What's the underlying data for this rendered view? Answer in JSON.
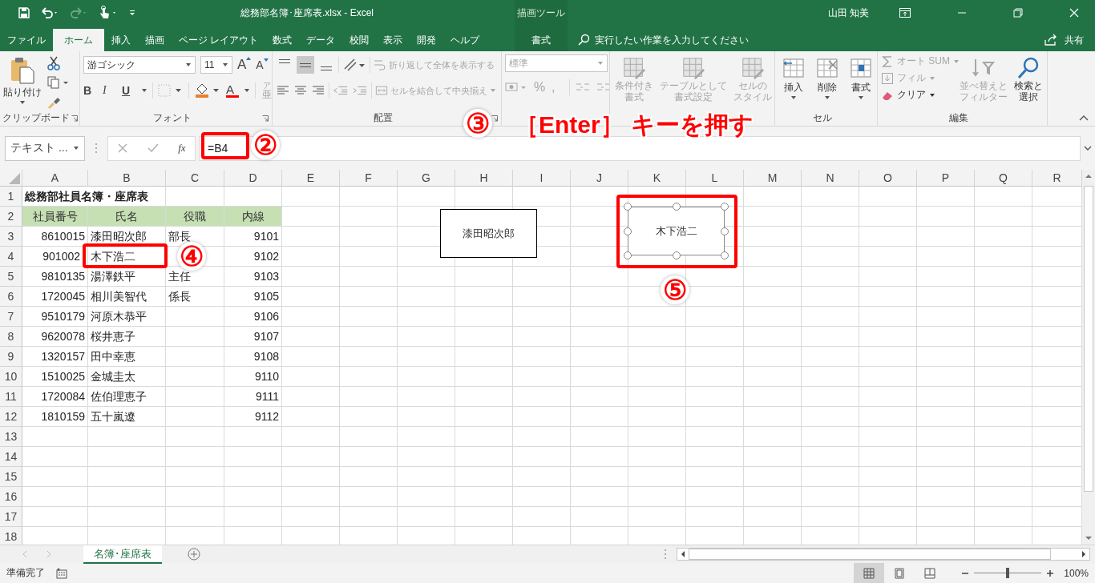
{
  "window": {
    "title": "総務部名簿･座席表.xlsx  -  Excel",
    "context_tool": "描画ツール",
    "user": "山田 知美"
  },
  "tabs": [
    {
      "label": "ファイル",
      "selected": false,
      "kind": "file"
    },
    {
      "label": "ホーム",
      "selected": true,
      "kind": "normal"
    },
    {
      "label": "挿入",
      "selected": false,
      "kind": "normal"
    },
    {
      "label": "描画",
      "selected": false,
      "kind": "normal"
    },
    {
      "label": "ページ レイアウト",
      "selected": false,
      "kind": "normal"
    },
    {
      "label": "数式",
      "selected": false,
      "kind": "normal"
    },
    {
      "label": "データ",
      "selected": false,
      "kind": "normal"
    },
    {
      "label": "校閲",
      "selected": false,
      "kind": "normal"
    },
    {
      "label": "表示",
      "selected": false,
      "kind": "normal"
    },
    {
      "label": "開発",
      "selected": false,
      "kind": "normal"
    },
    {
      "label": "ヘルプ",
      "selected": false,
      "kind": "normal"
    },
    {
      "label": "書式",
      "selected": false,
      "kind": "context"
    }
  ],
  "search": {
    "placeholder": "実行したい作業を入力してください"
  },
  "share": "共有",
  "ribbon": {
    "clipboard": {
      "paste": "貼り付け",
      "label": "クリップボード"
    },
    "font": {
      "name": "游ゴシック",
      "size": "11",
      "grow": "A",
      "shrink": "A",
      "styles": [
        "B",
        "I",
        "U"
      ],
      "color_label": "A",
      "phonetic_ruby": "ア",
      "phonetic_base": "亜",
      "label": "フォント"
    },
    "alignment": {
      "vertical": [
        {
          "selected": false
        },
        {
          "selected": true
        },
        {
          "selected": false
        }
      ],
      "wrap": {
        "label": "折り返して全体を表示する",
        "disabled": true
      },
      "merge": {
        "label": "セルを結合して中央揃え",
        "disabled": true
      },
      "label": "配置"
    },
    "number": {
      "format": "標準",
      "percent": "%",
      "comma": ",",
      "disabled": true
    },
    "styles": [
      {
        "lines": [
          "条件付き",
          "書式"
        ],
        "disabled": true
      },
      {
        "lines": [
          "テーブルとして",
          "書式設定"
        ],
        "disabled": true
      },
      {
        "lines": [
          "セルの",
          "スタイル"
        ],
        "disabled": true
      }
    ],
    "cells": {
      "buttons": [
        {
          "label": "挿入"
        },
        {
          "label": "削除"
        },
        {
          "label": "書式"
        }
      ],
      "label": "セル"
    },
    "editing": {
      "items": [
        {
          "label": "オート SUM",
          "disabled": true
        },
        {
          "label": "フィル",
          "disabled": true
        },
        {
          "label": "クリア",
          "disabled": false
        }
      ],
      "sort": {
        "lines": [
          "並べ替えと",
          "フィルター"
        ],
        "disabled": true
      },
      "find": {
        "lines": [
          "検索と",
          "選択"
        ],
        "disabled": false
      },
      "label": "編集"
    }
  },
  "formula_bar": {
    "name_box": "テキスト ...",
    "fx": "fx",
    "value": "=B4"
  },
  "sheet": {
    "columns": [
      "A",
      "B",
      "C",
      "D",
      "E",
      "F",
      "G",
      "H",
      "I",
      "J",
      "K",
      "L",
      "M",
      "N",
      "O",
      "P",
      "Q",
      "R"
    ],
    "row_numbers": [
      "1",
      "2",
      "3",
      "4",
      "5",
      "6",
      "7",
      "8",
      "9",
      "10",
      "11",
      "12",
      "13",
      "14",
      "15",
      "16",
      "17",
      "18"
    ],
    "title": "総務部社員名簿・座席表",
    "headers": [
      "社員番号",
      "氏名",
      "役職",
      "内線"
    ],
    "rows": [
      {
        "id": "8610015",
        "name": "漆田昭次郎",
        "role": "部長",
        "ext": "9101"
      },
      {
        "id": "901002",
        "name": "木下浩二",
        "ext": "9102"
      },
      {
        "id": "9810135",
        "name": "湯澤鉄平",
        "role": "主任",
        "ext": "9103"
      },
      {
        "id": "1720045",
        "name": "相川美智代",
        "role": "係長",
        "ext": "9105"
      },
      {
        "id": "9510179",
        "name": "河原木恭平",
        "ext": "9106"
      },
      {
        "id": "9620078",
        "name": "桜井恵子",
        "ext": "9107"
      },
      {
        "id": "1320157",
        "name": "田中幸恵",
        "ext": "9108"
      },
      {
        "id": "1510025",
        "name": "金城圭太",
        "ext": "9110"
      },
      {
        "id": "1720084",
        "name": "佐伯理恵子",
        "ext": "9111"
      },
      {
        "id": "1810159",
        "name": "五十嵐遼",
        "ext": "9112"
      }
    ]
  },
  "shapes": [
    {
      "text": "漆田昭次郎",
      "selected": false
    },
    {
      "text": "木下浩二",
      "selected": true
    }
  ],
  "annotations": {
    "steps": [
      "②",
      "③",
      "④",
      "⑤"
    ],
    "instruction": "［Enter］ キーを押す"
  },
  "sheet_tabs": [
    {
      "label": "名簿･座席表",
      "selected": true
    }
  ],
  "status_bar": {
    "status": "準備完了",
    "views": [
      {
        "kind": "normal",
        "selected": true
      },
      {
        "kind": "layout",
        "selected": false
      },
      {
        "kind": "break",
        "selected": false
      }
    ],
    "zoom": {
      "level": 0.5,
      "reading": "100%"
    }
  }
}
